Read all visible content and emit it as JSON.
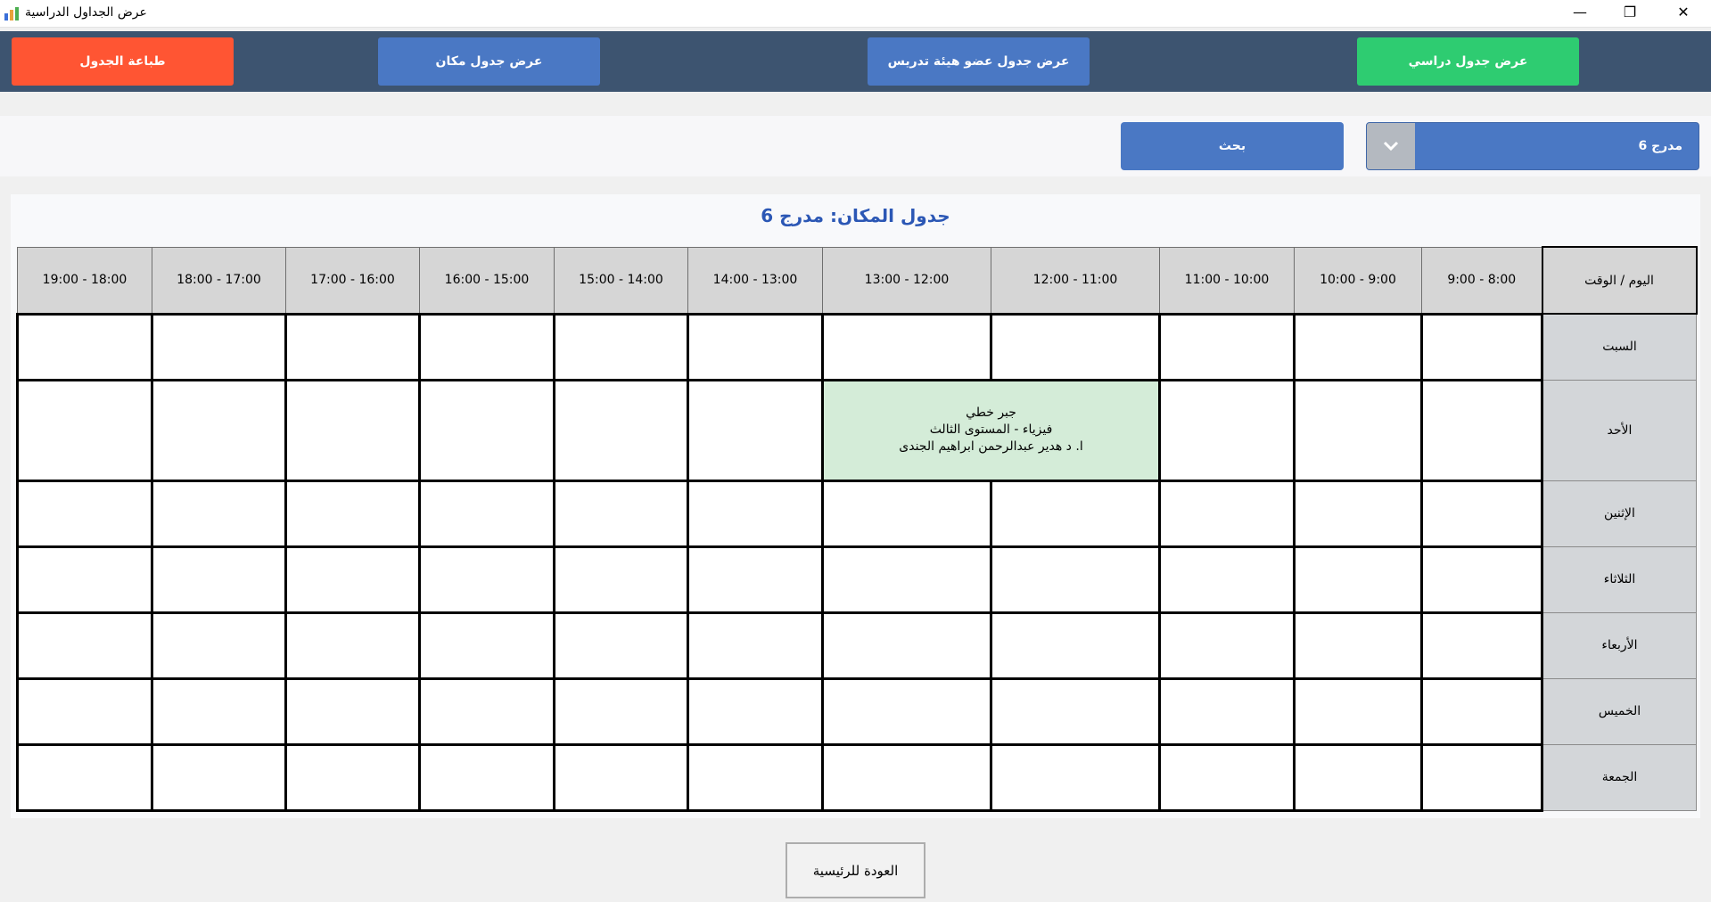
{
  "window": {
    "title": "عرض الجداول الدراسية",
    "minimize_glyph": "—",
    "restore_glyph": "❐",
    "close_glyph": "✕"
  },
  "toolbar": {
    "print_label": "طباعة الجدول",
    "place_schedule_label": "عرض جدول مكان",
    "staff_schedule_label": "عرض جدول عضو هيئة تدريس",
    "study_schedule_label": "عرض جدول دراسي",
    "print_color": "#ff5533",
    "blue_color": "#4a78c4",
    "green_color": "#2ecc71"
  },
  "search": {
    "selected_place": "مدرج 6",
    "button_label": "بحث"
  },
  "schedule": {
    "title": "جدول المكان: مدرج 6",
    "corner_label": "اليوم / الوقت",
    "time_slots": [
      "8:00 - 9:00",
      "9:00 - 10:00",
      "10:00 - 11:00",
      "11:00 - 12:00",
      "12:00 - 13:00",
      "13:00 - 14:00",
      "14:00 - 15:00",
      "15:00 - 16:00",
      "16:00 - 17:00",
      "17:00 - 18:00",
      "18:00 - 19:00"
    ],
    "days": [
      "السبت",
      "الأحد",
      "الإثنين",
      "الثلاثاء",
      "الأربعاء",
      "الخميس",
      "الجمعة"
    ],
    "lesson": {
      "day": "الأحد",
      "slots": [
        "11:00 - 12:00",
        "12:00 - 13:00"
      ],
      "course": "جبر خطي",
      "group": "فيزياء - المستوى الثالث",
      "instructor": "ا. د هدير  عبدالرحمن ابراهيم الجندى",
      "color": "#d4ecd8"
    }
  },
  "footer": {
    "back_label": "العودة للرئيسية"
  }
}
